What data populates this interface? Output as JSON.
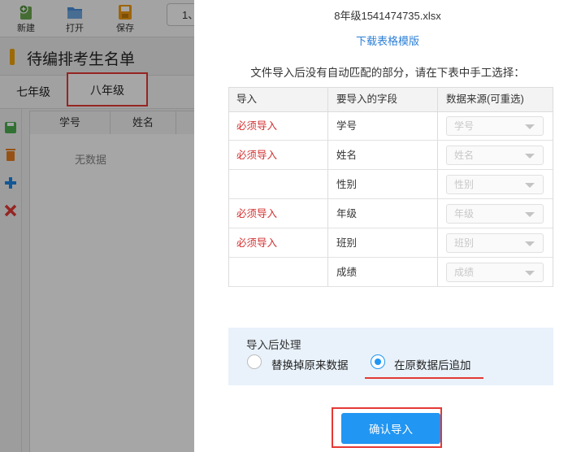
{
  "toolbar": {
    "new_label": "新建",
    "open_label": "打开",
    "save_label": "保存",
    "input_value": "1、"
  },
  "page_title": "待编排考生名单",
  "tabs": [
    {
      "label": "七年级"
    },
    {
      "label": "八年级"
    }
  ],
  "grid": {
    "columns": [
      "学号",
      "姓名"
    ],
    "empty_text": "无数据"
  },
  "dialog": {
    "filename": "8年级1541474735.xlsx",
    "template_link": "下载表格模版",
    "instruction": "文件导入后没有自动匹配的部分，请在下表中手工选择：",
    "headers": [
      "导入",
      "要导入的字段",
      "数据来源(可重选)"
    ],
    "rows": [
      {
        "required": "必须导入",
        "field": "学号",
        "source": "学号"
      },
      {
        "required": "必须导入",
        "field": "姓名",
        "source": "姓名"
      },
      {
        "required": "",
        "field": "性别",
        "source": "性别"
      },
      {
        "required": "必须导入",
        "field": "年级",
        "source": "年级"
      },
      {
        "required": "必须导入",
        "field": "班别",
        "source": "班别"
      },
      {
        "required": "",
        "field": "成绩",
        "source": "成绩"
      }
    ],
    "post_process": {
      "title": "导入后处理",
      "options": [
        "替换掉原来数据",
        "在原数据后追加"
      ],
      "selected": "在原数据后追加"
    },
    "confirm_label": "确认导入"
  },
  "colors": {
    "accent": "#2196f3",
    "required_text": "#d32f2f",
    "highlight": "#e53935",
    "link": "#2b7fd6"
  }
}
